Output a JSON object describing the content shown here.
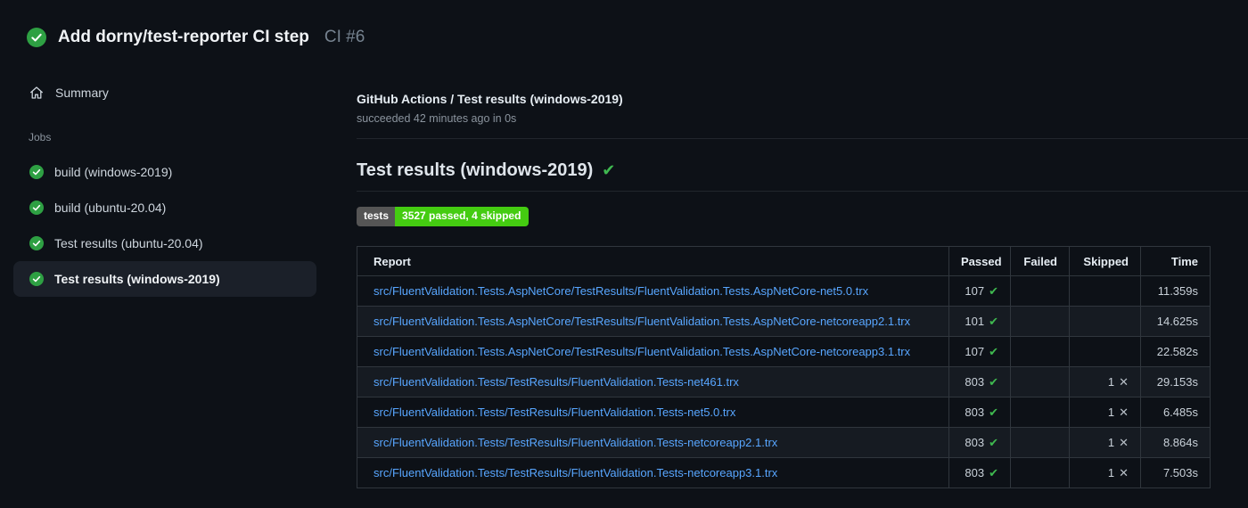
{
  "header": {
    "title": "Add dorny/test-reporter CI step",
    "run_number": "CI #6"
  },
  "sidebar": {
    "summary_label": "Summary",
    "jobs_label": "Jobs",
    "jobs": [
      {
        "label": "build (windows-2019)",
        "selected": false
      },
      {
        "label": "build (ubuntu-20.04)",
        "selected": false
      },
      {
        "label": "Test results (ubuntu-20.04)",
        "selected": false
      },
      {
        "label": "Test results (windows-2019)",
        "selected": true
      }
    ]
  },
  "main": {
    "check_title": "GitHub Actions / Test results (windows-2019)",
    "check_status": "succeeded 42 minutes ago in 0s",
    "section_title": "Test results (windows-2019)",
    "badge": {
      "label": "tests",
      "value": "3527 passed, 4 skipped",
      "label_bg": "#555555",
      "value_bg": "#44cc11"
    },
    "table": {
      "columns": [
        "Report",
        "Passed",
        "Failed",
        "Skipped",
        "Time"
      ],
      "rows": [
        {
          "report": "src/FluentValidation.Tests.AspNetCore/TestResults/FluentValidation.Tests.AspNetCore-net5.0.trx",
          "passed": "107",
          "failed": "",
          "skipped": "",
          "time": "11.359s"
        },
        {
          "report": "src/FluentValidation.Tests.AspNetCore/TestResults/FluentValidation.Tests.AspNetCore-netcoreapp2.1.trx",
          "passed": "101",
          "failed": "",
          "skipped": "",
          "time": "14.625s"
        },
        {
          "report": "src/FluentValidation.Tests.AspNetCore/TestResults/FluentValidation.Tests.AspNetCore-netcoreapp3.1.trx",
          "passed": "107",
          "failed": "",
          "skipped": "",
          "time": "22.582s"
        },
        {
          "report": "src/FluentValidation.Tests/TestResults/FluentValidation.Tests-net461.trx",
          "passed": "803",
          "failed": "",
          "skipped": "1",
          "time": "29.153s"
        },
        {
          "report": "src/FluentValidation.Tests/TestResults/FluentValidation.Tests-net5.0.trx",
          "passed": "803",
          "failed": "",
          "skipped": "1",
          "time": "6.485s"
        },
        {
          "report": "src/FluentValidation.Tests/TestResults/FluentValidation.Tests-netcoreapp2.1.trx",
          "passed": "803",
          "failed": "",
          "skipped": "1",
          "time": "8.864s"
        },
        {
          "report": "src/FluentValidation.Tests/TestResults/FluentValidation.Tests-netcoreapp3.1.trx",
          "passed": "803",
          "failed": "",
          "skipped": "1",
          "time": "7.503s"
        }
      ]
    }
  },
  "icons": {
    "success_circle": "check-circle-icon",
    "home": "home-icon",
    "passed_mark": "✔",
    "skipped_mark": "✕",
    "heading_mark": "✔"
  },
  "colors": {
    "page_bg": "#0d1117",
    "link_blue": "#58a6ff",
    "success_green": "#3fb950",
    "circle_green": "#2ea043",
    "table_border": "#30363d",
    "row_alt_bg": "#161b22",
    "badge_label_bg": "#555555",
    "badge_value_bg": "#44cc11"
  }
}
